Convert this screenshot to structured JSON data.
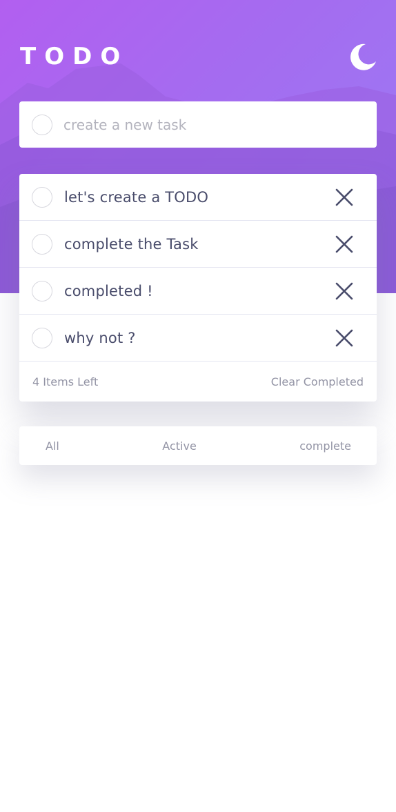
{
  "header": {
    "title": "TODO",
    "theme_icon": "moon-icon"
  },
  "new_task": {
    "placeholder": "create a new task",
    "value": ""
  },
  "tasks": [
    {
      "text": "let's create a TODO",
      "completed": false
    },
    {
      "text": "complete the Task",
      "completed": false
    },
    {
      "text": "completed !",
      "completed": false
    },
    {
      "text": "why not ?",
      "completed": false
    }
  ],
  "footer": {
    "items_left": "4 Items Left",
    "clear_label": "Clear Completed"
  },
  "filters": {
    "all": "All",
    "active": "Active",
    "complete": "complete"
  },
  "colors": {
    "gradient_start": "#b25ff0",
    "gradient_end": "#9b7cf4",
    "text": "#494c6b",
    "muted": "#9394a5"
  }
}
